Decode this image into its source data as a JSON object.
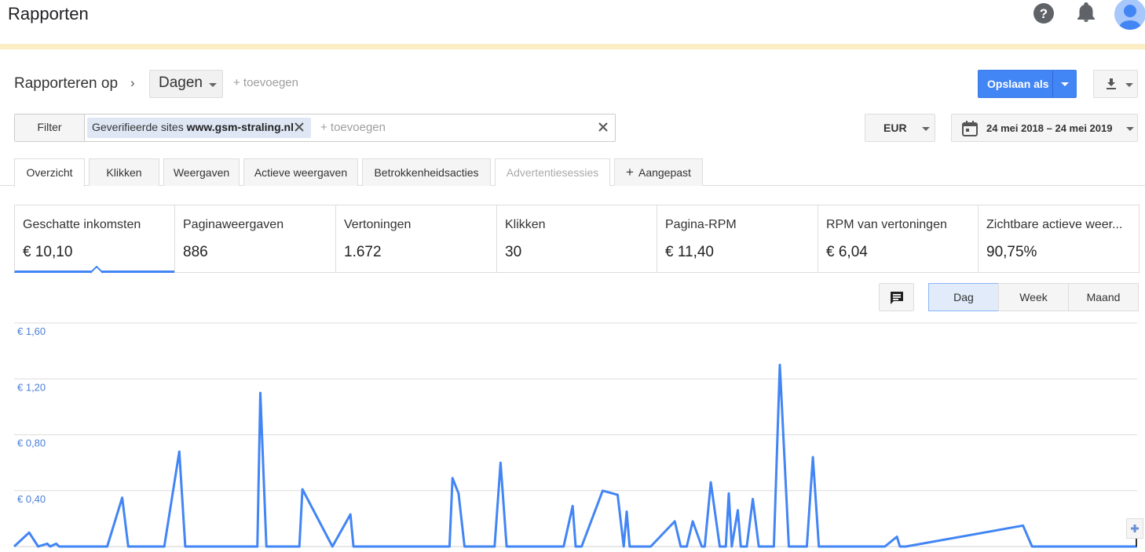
{
  "app": {
    "title": "Rapporten"
  },
  "report": {
    "title": "Rapporteren op",
    "dimension": "Dagen",
    "add_label": "+ toevoegen",
    "save_label": "Opslaan als"
  },
  "filter": {
    "button_label": "Filter",
    "chip_prefix": "Geverifieerde sites ",
    "chip_value": "www.gsm-straling.nl",
    "add_label": "+ toevoegen"
  },
  "currency": "EUR",
  "date_range": "24 mei 2018 – 24 mei 2019",
  "tabs": [
    {
      "label": "Overzicht"
    },
    {
      "label": "Klikken"
    },
    {
      "label": "Weergaven"
    },
    {
      "label": "Actieve weergaven"
    },
    {
      "label": "Betrokkenheidsacties"
    },
    {
      "label": "Advertentiesessies"
    },
    {
      "label": "Aangepast"
    }
  ],
  "metrics": [
    {
      "name": "Geschatte inkomsten",
      "value": "€ 10,10"
    },
    {
      "name": "Paginaweergaven",
      "value": "886"
    },
    {
      "name": "Vertoningen",
      "value": "1.672"
    },
    {
      "name": "Klikken",
      "value": "30"
    },
    {
      "name": "Pagina-RPM",
      "value": "€ 11,40"
    },
    {
      "name": "RPM van vertoningen",
      "value": "€ 6,04"
    },
    {
      "name": "Zichtbare actieve weer...",
      "value": "90,75%"
    }
  ],
  "granularity": [
    {
      "label": "Dag"
    },
    {
      "label": "Week"
    },
    {
      "label": "Maand"
    }
  ],
  "colors": {
    "accent": "#4285f4",
    "line": "#4285f4",
    "axis_label": "#4a7fd6"
  },
  "chart_data": {
    "type": "line",
    "xlabel": "",
    "ylabel": "",
    "ylim": [
      0,
      1.6
    ],
    "y_ticks": [
      "€ 0,40",
      "€ 0,80",
      "€ 1,20",
      "€ 1,60"
    ],
    "y_tick_values": [
      0.4,
      0.8,
      1.2,
      1.6
    ],
    "grid": true,
    "series": [
      {
        "x": [
          0,
          5,
          8,
          11,
          12,
          14,
          15,
          31,
          36,
          38,
          50,
          55,
          57,
          81,
          82,
          84,
          86,
          95,
          96,
          106,
          112,
          113,
          115,
          120,
          145,
          146,
          148,
          150,
          160,
          162,
          164,
          165,
          167,
          176,
          183,
          186,
          187,
          189,
          196,
          201,
          203,
          204,
          205,
          207,
          208,
          212,
          220,
          222,
          224,
          226,
          229,
          230,
          232,
          235,
          237,
          238,
          239,
          241,
          242,
          244,
          246,
          248,
          252,
          253,
          255,
          258,
          264,
          266,
          268,
          284,
          286,
          288,
          290,
          294,
          295,
          297,
          336,
          339,
          341,
          343,
          363,
          365,
          366,
          374
        ],
        "values": [
          0,
          0.1,
          0,
          0.02,
          0,
          0.02,
          0,
          0,
          0.35,
          0,
          0,
          0.68,
          0,
          0,
          1.1,
          0,
          0,
          0,
          0.41,
          0,
          0.23,
          0,
          0,
          0,
          0,
          0.49,
          0.38,
          0,
          0,
          0.6,
          0,
          0,
          0,
          0,
          0,
          0.29,
          0,
          0,
          0.4,
          0.37,
          0,
          0.25,
          0,
          0,
          0,
          0,
          0.18,
          0,
          0,
          0.18,
          0,
          0,
          0.46,
          0,
          0,
          0.38,
          0,
          0.26,
          0,
          0,
          0.34,
          0,
          0,
          0,
          1.3,
          0,
          0,
          0.64,
          0,
          0,
          0,
          0,
          0,
          0.07,
          0,
          0,
          0.15,
          0,
          0,
          0,
          0,
          0,
          0,
          0
        ]
      }
    ]
  }
}
